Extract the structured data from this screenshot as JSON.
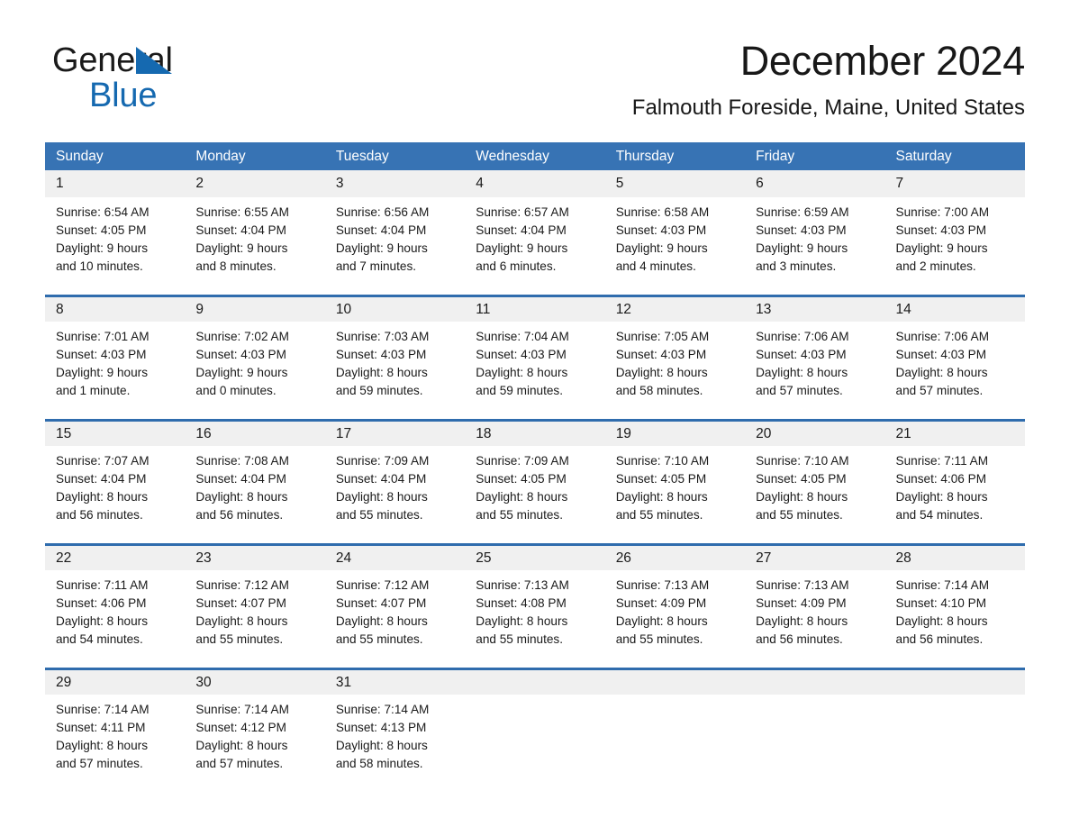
{
  "brand": {
    "line1": "General",
    "line2": "Blue",
    "triangle_color": "#1569b0"
  },
  "header": {
    "title": "December 2024",
    "subtitle": "Falmouth Foreside, Maine, United States"
  },
  "theme": {
    "header_blue": "#3773b4",
    "row_rule_blue": "#2f6cad",
    "daynum_band": "#f0f0f0",
    "page_background": "#ffffff",
    "text": "#1a1a1a"
  },
  "weekday_headers": [
    "Sunday",
    "Monday",
    "Tuesday",
    "Wednesday",
    "Thursday",
    "Friday",
    "Saturday"
  ],
  "weeks": [
    [
      {
        "day": "1",
        "lines": [
          "Sunrise: 6:54 AM",
          "Sunset: 4:05 PM",
          "Daylight: 9 hours",
          "and 10 minutes."
        ]
      },
      {
        "day": "2",
        "lines": [
          "Sunrise: 6:55 AM",
          "Sunset: 4:04 PM",
          "Daylight: 9 hours",
          "and 8 minutes."
        ]
      },
      {
        "day": "3",
        "lines": [
          "Sunrise: 6:56 AM",
          "Sunset: 4:04 PM",
          "Daylight: 9 hours",
          "and 7 minutes."
        ]
      },
      {
        "day": "4",
        "lines": [
          "Sunrise: 6:57 AM",
          "Sunset: 4:04 PM",
          "Daylight: 9 hours",
          "and 6 minutes."
        ]
      },
      {
        "day": "5",
        "lines": [
          "Sunrise: 6:58 AM",
          "Sunset: 4:03 PM",
          "Daylight: 9 hours",
          "and 4 minutes."
        ]
      },
      {
        "day": "6",
        "lines": [
          "Sunrise: 6:59 AM",
          "Sunset: 4:03 PM",
          "Daylight: 9 hours",
          "and 3 minutes."
        ]
      },
      {
        "day": "7",
        "lines": [
          "Sunrise: 7:00 AM",
          "Sunset: 4:03 PM",
          "Daylight: 9 hours",
          "and 2 minutes."
        ]
      }
    ],
    [
      {
        "day": "8",
        "lines": [
          "Sunrise: 7:01 AM",
          "Sunset: 4:03 PM",
          "Daylight: 9 hours",
          "and 1 minute."
        ]
      },
      {
        "day": "9",
        "lines": [
          "Sunrise: 7:02 AM",
          "Sunset: 4:03 PM",
          "Daylight: 9 hours",
          "and 0 minutes."
        ]
      },
      {
        "day": "10",
        "lines": [
          "Sunrise: 7:03 AM",
          "Sunset: 4:03 PM",
          "Daylight: 8 hours",
          "and 59 minutes."
        ]
      },
      {
        "day": "11",
        "lines": [
          "Sunrise: 7:04 AM",
          "Sunset: 4:03 PM",
          "Daylight: 8 hours",
          "and 59 minutes."
        ]
      },
      {
        "day": "12",
        "lines": [
          "Sunrise: 7:05 AM",
          "Sunset: 4:03 PM",
          "Daylight: 8 hours",
          "and 58 minutes."
        ]
      },
      {
        "day": "13",
        "lines": [
          "Sunrise: 7:06 AM",
          "Sunset: 4:03 PM",
          "Daylight: 8 hours",
          "and 57 minutes."
        ]
      },
      {
        "day": "14",
        "lines": [
          "Sunrise: 7:06 AM",
          "Sunset: 4:03 PM",
          "Daylight: 8 hours",
          "and 57 minutes."
        ]
      }
    ],
    [
      {
        "day": "15",
        "lines": [
          "Sunrise: 7:07 AM",
          "Sunset: 4:04 PM",
          "Daylight: 8 hours",
          "and 56 minutes."
        ]
      },
      {
        "day": "16",
        "lines": [
          "Sunrise: 7:08 AM",
          "Sunset: 4:04 PM",
          "Daylight: 8 hours",
          "and 56 minutes."
        ]
      },
      {
        "day": "17",
        "lines": [
          "Sunrise: 7:09 AM",
          "Sunset: 4:04 PM",
          "Daylight: 8 hours",
          "and 55 minutes."
        ]
      },
      {
        "day": "18",
        "lines": [
          "Sunrise: 7:09 AM",
          "Sunset: 4:05 PM",
          "Daylight: 8 hours",
          "and 55 minutes."
        ]
      },
      {
        "day": "19",
        "lines": [
          "Sunrise: 7:10 AM",
          "Sunset: 4:05 PM",
          "Daylight: 8 hours",
          "and 55 minutes."
        ]
      },
      {
        "day": "20",
        "lines": [
          "Sunrise: 7:10 AM",
          "Sunset: 4:05 PM",
          "Daylight: 8 hours",
          "and 55 minutes."
        ]
      },
      {
        "day": "21",
        "lines": [
          "Sunrise: 7:11 AM",
          "Sunset: 4:06 PM",
          "Daylight: 8 hours",
          "and 54 minutes."
        ]
      }
    ],
    [
      {
        "day": "22",
        "lines": [
          "Sunrise: 7:11 AM",
          "Sunset: 4:06 PM",
          "Daylight: 8 hours",
          "and 54 minutes."
        ]
      },
      {
        "day": "23",
        "lines": [
          "Sunrise: 7:12 AM",
          "Sunset: 4:07 PM",
          "Daylight: 8 hours",
          "and 55 minutes."
        ]
      },
      {
        "day": "24",
        "lines": [
          "Sunrise: 7:12 AM",
          "Sunset: 4:07 PM",
          "Daylight: 8 hours",
          "and 55 minutes."
        ]
      },
      {
        "day": "25",
        "lines": [
          "Sunrise: 7:13 AM",
          "Sunset: 4:08 PM",
          "Daylight: 8 hours",
          "and 55 minutes."
        ]
      },
      {
        "day": "26",
        "lines": [
          "Sunrise: 7:13 AM",
          "Sunset: 4:09 PM",
          "Daylight: 8 hours",
          "and 55 minutes."
        ]
      },
      {
        "day": "27",
        "lines": [
          "Sunrise: 7:13 AM",
          "Sunset: 4:09 PM",
          "Daylight: 8 hours",
          "and 56 minutes."
        ]
      },
      {
        "day": "28",
        "lines": [
          "Sunrise: 7:14 AM",
          "Sunset: 4:10 PM",
          "Daylight: 8 hours",
          "and 56 minutes."
        ]
      }
    ],
    [
      {
        "day": "29",
        "lines": [
          "Sunrise: 7:14 AM",
          "Sunset: 4:11 PM",
          "Daylight: 8 hours",
          "and 57 minutes."
        ]
      },
      {
        "day": "30",
        "lines": [
          "Sunrise: 7:14 AM",
          "Sunset: 4:12 PM",
          "Daylight: 8 hours",
          "and 57 minutes."
        ]
      },
      {
        "day": "31",
        "lines": [
          "Sunrise: 7:14 AM",
          "Sunset: 4:13 PM",
          "Daylight: 8 hours",
          "and 58 minutes."
        ]
      },
      {
        "day": "",
        "lines": []
      },
      {
        "day": "",
        "lines": []
      },
      {
        "day": "",
        "lines": []
      },
      {
        "day": "",
        "lines": []
      }
    ]
  ]
}
